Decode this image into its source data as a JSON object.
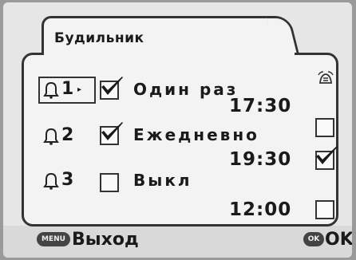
{
  "dialog": {
    "title": "Будильник",
    "alarms": [
      {
        "index": "1",
        "enabled": true,
        "mode": "Один раз",
        "time": "17:30",
        "snooze": false,
        "selected": true
      },
      {
        "index": "2",
        "enabled": true,
        "mode": "Ежедневно",
        "time": "19:30",
        "snooze": true,
        "selected": false
      },
      {
        "index": "3",
        "enabled": false,
        "mode": "Выкл",
        "time": "12:00",
        "snooze": false,
        "selected": false
      }
    ],
    "snooze_header_icon": "snooze-bell-icon"
  },
  "footer": {
    "menu_key": "MENU",
    "exit_label": "Выход",
    "ok_key": "OK",
    "ok_label": "OK"
  },
  "colors": {
    "screen_bg": "#e6e6e6",
    "panel_bg": "#f3f3f3",
    "outline": "#333333"
  }
}
